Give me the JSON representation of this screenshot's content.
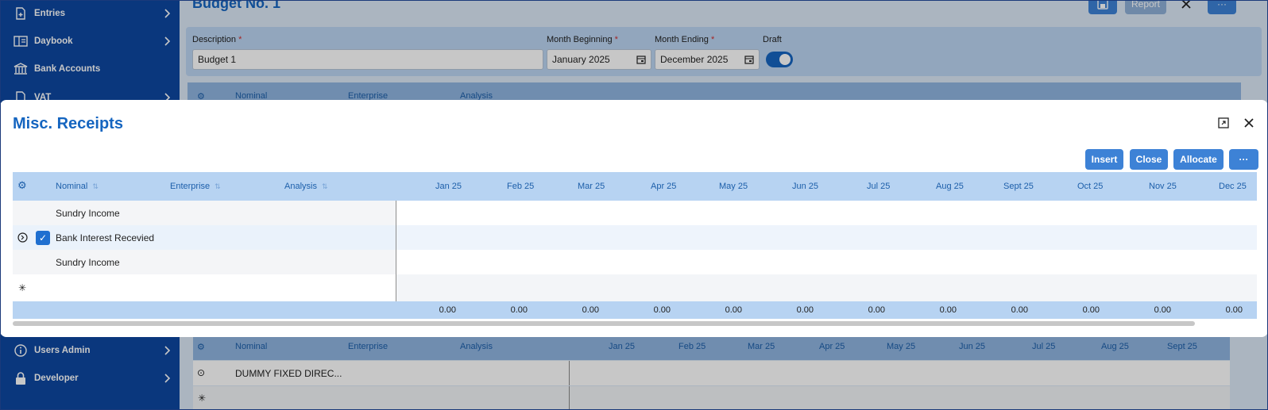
{
  "sidebar": {
    "items": [
      {
        "label": "Entries",
        "icon": "document-add-icon"
      },
      {
        "label": "Daybook",
        "icon": "book-icon"
      },
      {
        "label": "Bank Accounts",
        "icon": "bank-icon"
      },
      {
        "label": "VAT",
        "icon": "document-icon"
      },
      {
        "label": "Users Admin",
        "icon": "info-icon"
      },
      {
        "label": "Developer",
        "icon": "lock-icon"
      }
    ]
  },
  "background_page": {
    "title": "Budget No. 1",
    "report_label": "Report",
    "form": {
      "description_label": "Description",
      "description_value": "Budget 1",
      "month_beginning_label": "Month Beginning",
      "month_beginning_value": "January 2025",
      "month_ending_label": "Month Ending",
      "month_ending_value": "December 2025",
      "draft_label": "Draft",
      "draft_on": true,
      "required_mark": "*"
    },
    "grid_columns": [
      "Nominal",
      "Enterprise",
      "Analysis",
      "Jan 25",
      "Feb 25",
      "Mar 25",
      "Apr 25",
      "May 25",
      "Jun 25",
      "Jul 25",
      "Aug 25",
      "Sept 25"
    ],
    "lower_row": "DUMMY FIXED DIREC...",
    "new_row_marker": "✳"
  },
  "modal": {
    "title": "Misc. Receipts",
    "buttons": {
      "insert": "Insert",
      "close": "Close",
      "allocate": "Allocate",
      "more": "···"
    },
    "columns": {
      "nominal": "Nominal",
      "enterprise": "Enterprise",
      "analysis": "Analysis",
      "months": [
        "Jan 25",
        "Feb 25",
        "Mar 25",
        "Apr 25",
        "May 25",
        "Jun 25",
        "Jul 25",
        "Aug 25",
        "Sept 25",
        "Oct 25",
        "Nov 25",
        "Dec 25"
      ]
    },
    "rows": [
      {
        "nominal": "Sundry Income",
        "selected": false
      },
      {
        "nominal": "Bank Interest Recevied",
        "selected": true
      },
      {
        "nominal": "Sundry Income",
        "selected": false
      }
    ],
    "new_row_marker": "✳",
    "totals": [
      "0.00",
      "0.00",
      "0.00",
      "0.00",
      "0.00",
      "0.00",
      "0.00",
      "0.00",
      "0.00",
      "0.00",
      "0.00",
      "0.00"
    ]
  },
  "colors": {
    "sidebar": "#0d47a1",
    "accent": "#1565c0",
    "button": "#3d82d6",
    "grid_header": "#b7d3f2"
  }
}
